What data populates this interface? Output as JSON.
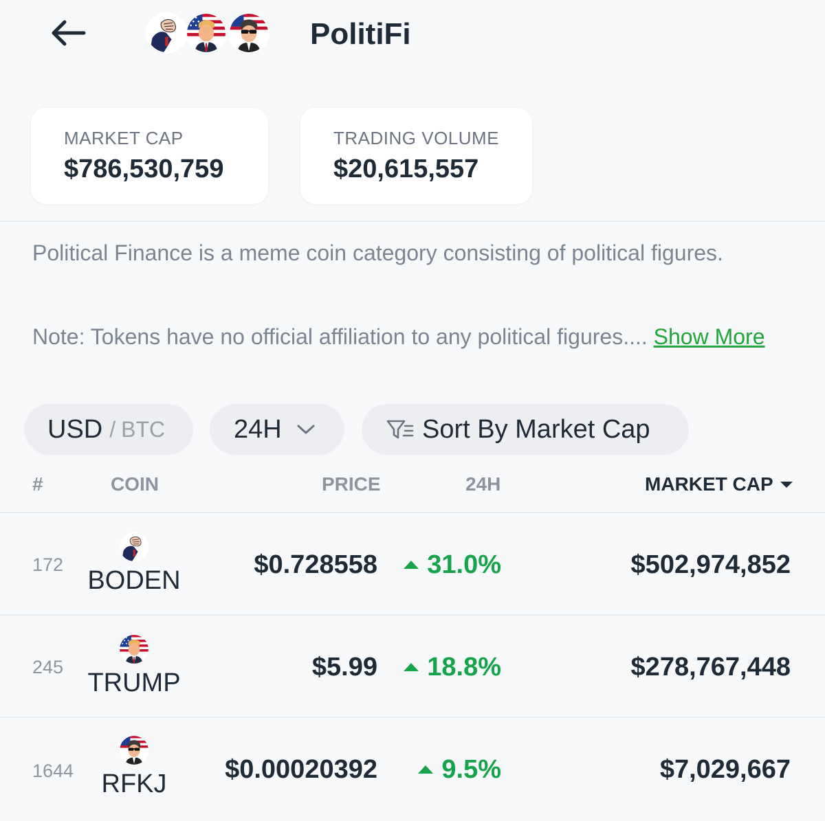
{
  "header": {
    "title": "PolitiFi",
    "back_icon": "arrow-left-icon",
    "avatars": [
      "boden-avatar",
      "trump-avatar",
      "rfkj-avatar"
    ]
  },
  "stats": {
    "market_cap_label": "MARKET CAP",
    "market_cap_value": "$786,530,759",
    "volume_label": "TRADING VOLUME",
    "volume_value": "$20,615,557"
  },
  "description": {
    "para1": "Political Finance is a meme coin category consisting of political figures.",
    "para2": "Note: Tokens have no official affiliation to any political figures....",
    "show_more": "Show More"
  },
  "filters": {
    "currency_active": "USD",
    "currency_sep": "/",
    "currency_other": "BTC",
    "timeframe": "24H",
    "sort_label": "Sort By Market Cap"
  },
  "table": {
    "headers": {
      "rank": "#",
      "coin": "COIN",
      "price": "PRICE",
      "change": "24H",
      "market_cap": "MARKET CAP"
    },
    "rows": [
      {
        "rank": "172",
        "symbol": "BODEN",
        "price": "$0.728558",
        "change": "31.0%",
        "market_cap": "$502,974,852"
      },
      {
        "rank": "245",
        "symbol": "TRUMP",
        "price": "$5.99",
        "change": "18.8%",
        "market_cap": "$278,767,448"
      },
      {
        "rank": "1644",
        "symbol": "RFKJ",
        "price": "$0.00020392",
        "change": "9.5%",
        "market_cap": "$7,029,667"
      }
    ]
  },
  "colors": {
    "positive": "#16a34a",
    "link": "#22a53a",
    "text": "#1f2a37",
    "muted": "#8c949f",
    "background": "#f7f8fa"
  }
}
